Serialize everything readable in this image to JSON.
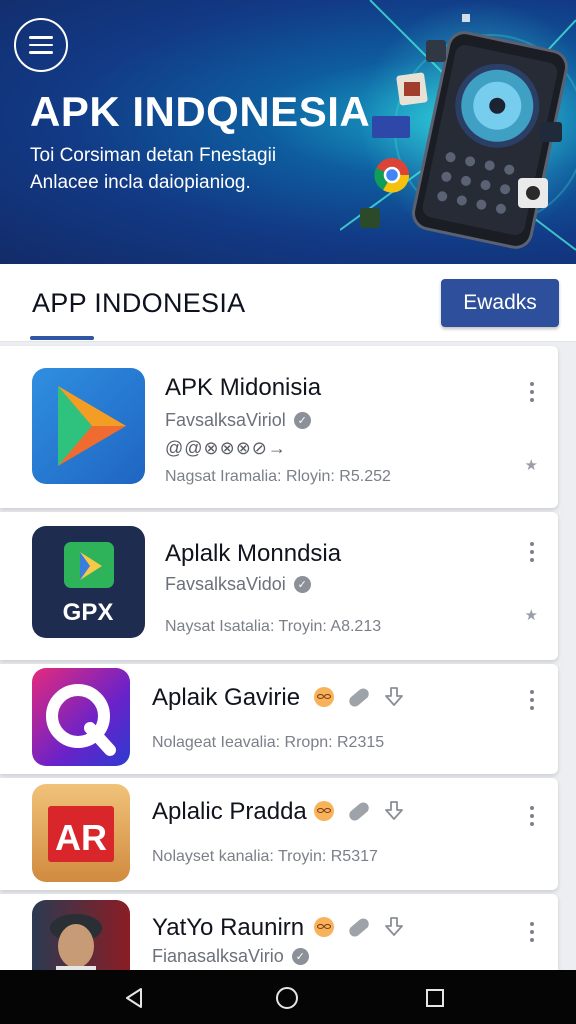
{
  "hero": {
    "title": "APK INDQNESIA",
    "subtitle_line1": "Toi Corsiman detan Fnestagii",
    "subtitle_line2": "Anlacee incla daiopianiog."
  },
  "tabbar": {
    "tab_label": "APP INDONESIA",
    "action_label": "Ewadks",
    "accent": "#2e4f9c"
  },
  "apps": [
    {
      "name": "APK Midonisia",
      "developer": "FavsalksaViriol",
      "rating_text": "@@⊗⊗⊗⊘→",
      "meta": "Nagsat Iramalia: Rloyin: R5.252",
      "icon": "play-triangle-icon"
    },
    {
      "name": "Aplalk Monndsia",
      "developer": "FavsalksaVidoi",
      "meta": "Naysat Isatalia: Troyin: A8.213",
      "icon_text": "GPX",
      "icon": "gpx-play-icon"
    },
    {
      "name": "Aplaik Gavirie",
      "meta": "Nolageat Ieavalia: Rropn: R2315",
      "icon": "q-logo-icon"
    },
    {
      "name": "Aplalic Pradda",
      "meta": "Nolayset kanalia: Troyin: R5317",
      "icon_text": "AR",
      "icon": "ar-logo-icon"
    },
    {
      "name": "YatYo Raunirn",
      "developer": "FianasalksaVirio",
      "icon": "portrait-icon"
    }
  ]
}
